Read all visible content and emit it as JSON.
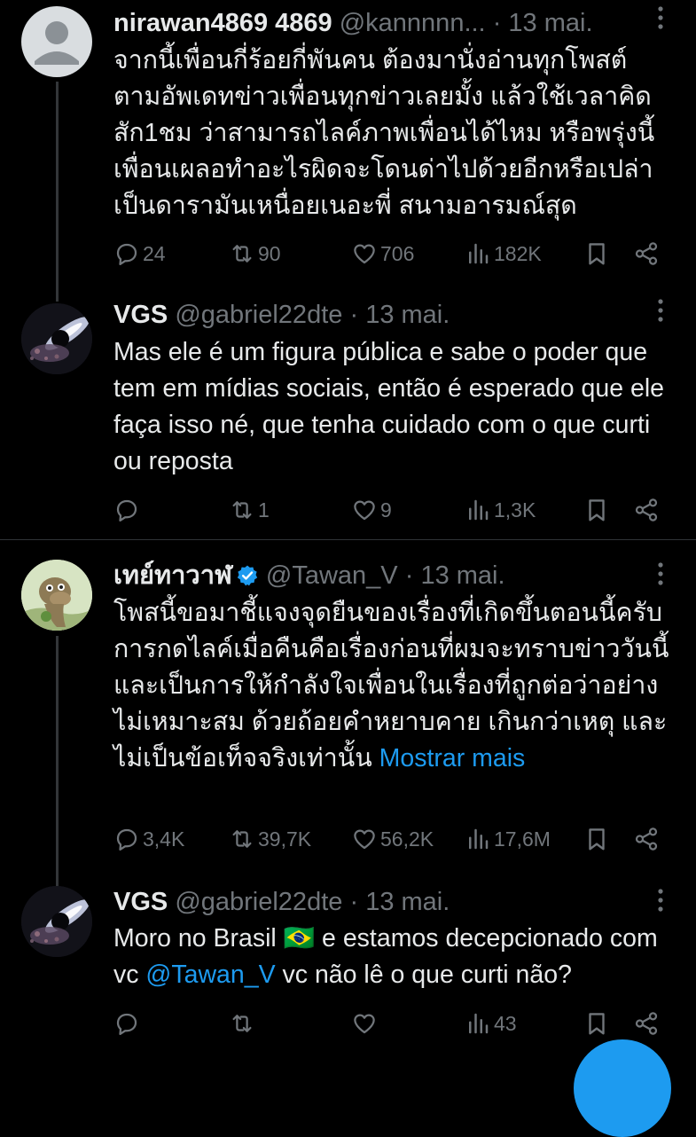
{
  "tweets": [
    {
      "name": "nirawan4869 4869",
      "handle": "@kannnnn...",
      "date": "13 mai.",
      "text": "จากนี้เพื่อนกี่ร้อยกี่พันคน ต้องมานั่งอ่านทุกโพสต์ตามอัพเดทข่าวเพื่อนทุกข่าวเลยมั้ง แล้วใช้เวลาคิดสัก1ชม ว่าสามารถไลค์ภาพเพื่อนได้ไหม หรือพรุ่งนี้เพื่อนเผลอทำอะไรผิดจะโดนด่าไปด้วยอีกหรือเปล่าเป็นดารามันเหนื่อยเนอะพี่ สนามอารมณ์สุด",
      "replies": "24",
      "reposts": "90",
      "likes": "706",
      "views": "182K"
    },
    {
      "name": "VGS",
      "handle": "@gabriel22dte",
      "date": "13 mai.",
      "text": "Mas ele é um figura pública e sabe o poder que tem em mídias sociais, então é esperado que ele faça isso né, que tenha cuidado com o que curti ou reposta",
      "replies": "",
      "reposts": "1",
      "likes": "9",
      "views": "1,3K"
    },
    {
      "name": "เทย์ทาวาฬ",
      "handle": "@Tawan_V",
      "date": "13 mai.",
      "text": "โพสนี้ขอมาชี้แจงจุดยืนของเรื่องที่เกิดขึ้นตอนนี้ครับ การกดไลค์เมื่อคืนคือเรื่องก่อนที่ผมจะทราบข่าววันนี้และเป็นการให้กำลังใจเพื่อนในเรื่องที่ถูกต่อว่าอย่างไม่เหมาะสม ด้วยถ้อยคำหยาบคาย เกินกว่าเหตุ และไม่เป็นข้อเท็จจริงเท่านั้น",
      "show_more": "Mostrar mais",
      "replies": "3,4K",
      "reposts": "39,7K",
      "likes": "56,2K",
      "views": "17,6M"
    },
    {
      "name": "VGS",
      "handle": "@gabriel22dte",
      "date": "13 mai.",
      "text_before": "Moro no Brasil 🇧🇷 e estamos decepcionado com vc ",
      "mention": "@Tawan_V",
      "text_after": " vc não lê o que curti não?",
      "replies": "",
      "reposts": "",
      "likes": "",
      "views": "43"
    }
  ],
  "sep": "·",
  "colors": {
    "background": "#000000",
    "text": "#e7e9ea",
    "muted": "#71767b",
    "link": "#1d9bf0",
    "verified": "#1d9bf0"
  }
}
